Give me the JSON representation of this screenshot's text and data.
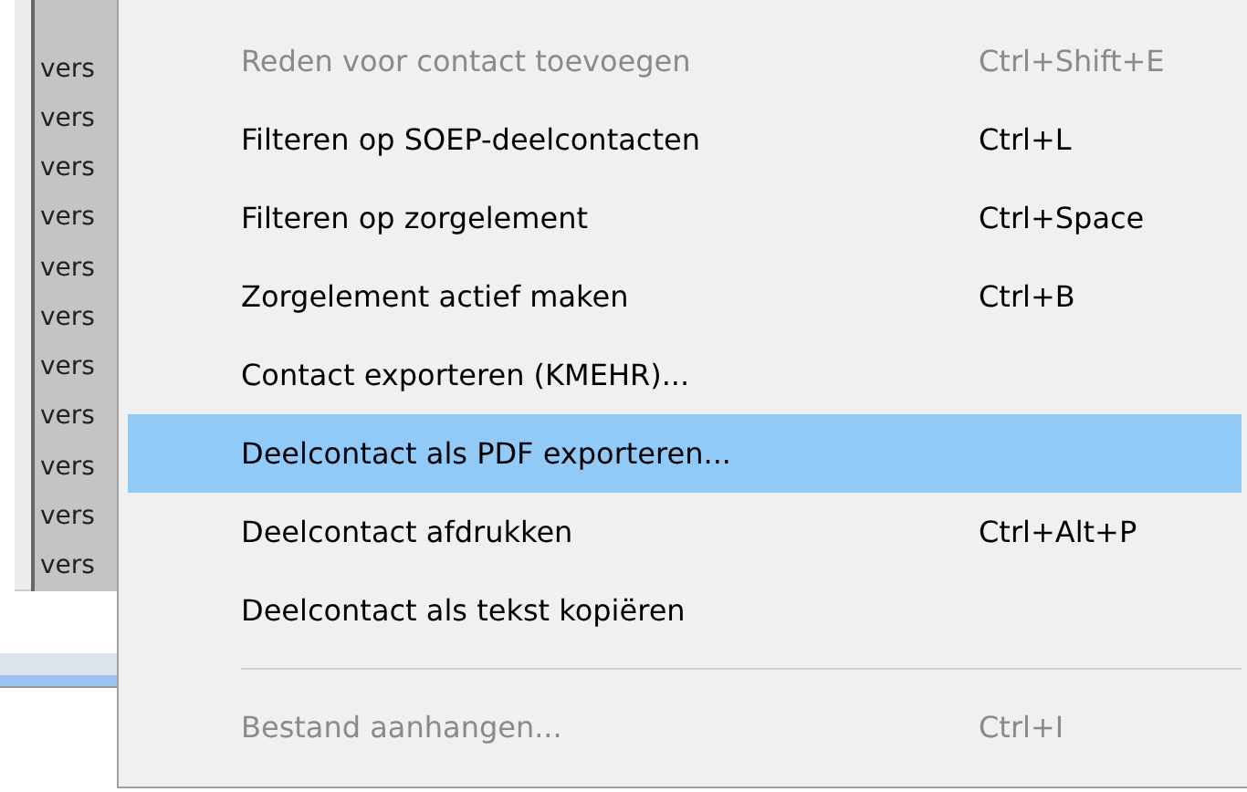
{
  "background_list": {
    "rows": [
      "vers",
      "vers",
      "vers",
      "vers",
      "vers",
      "vers",
      "vers",
      "vers",
      "vers",
      "vers",
      "vers"
    ]
  },
  "context_menu": {
    "items": [
      {
        "kind": "item",
        "label": "Reden voor contact toevoegen",
        "shortcut": "Ctrl+Shift+E",
        "disabled": true,
        "selected": false
      },
      {
        "kind": "item",
        "label": "Filteren op SOEP-deelcontacten",
        "shortcut": "Ctrl+L",
        "disabled": false,
        "selected": false
      },
      {
        "kind": "item",
        "label": "Filteren op zorgelement",
        "shortcut": "Ctrl+Space",
        "disabled": false,
        "selected": false
      },
      {
        "kind": "item",
        "label": "Zorgelement actief maken",
        "shortcut": "Ctrl+B",
        "disabled": false,
        "selected": false
      },
      {
        "kind": "item",
        "label": "Contact exporteren (KMEHR)...",
        "disabled": false,
        "selected": false
      },
      {
        "kind": "item",
        "label": "Deelcontact als PDF exporteren...",
        "disabled": false,
        "selected": true
      },
      {
        "kind": "item",
        "label": "Deelcontact afdrukken",
        "shortcut": "Ctrl+Alt+P",
        "disabled": false,
        "selected": false
      },
      {
        "kind": "item",
        "label": "Deelcontact als tekst kopiëren",
        "disabled": false,
        "selected": false
      },
      {
        "kind": "separator"
      },
      {
        "kind": "item",
        "label": "Bestand aanhangen...",
        "shortcut": "Ctrl+I",
        "disabled": true,
        "selected": false
      }
    ]
  }
}
